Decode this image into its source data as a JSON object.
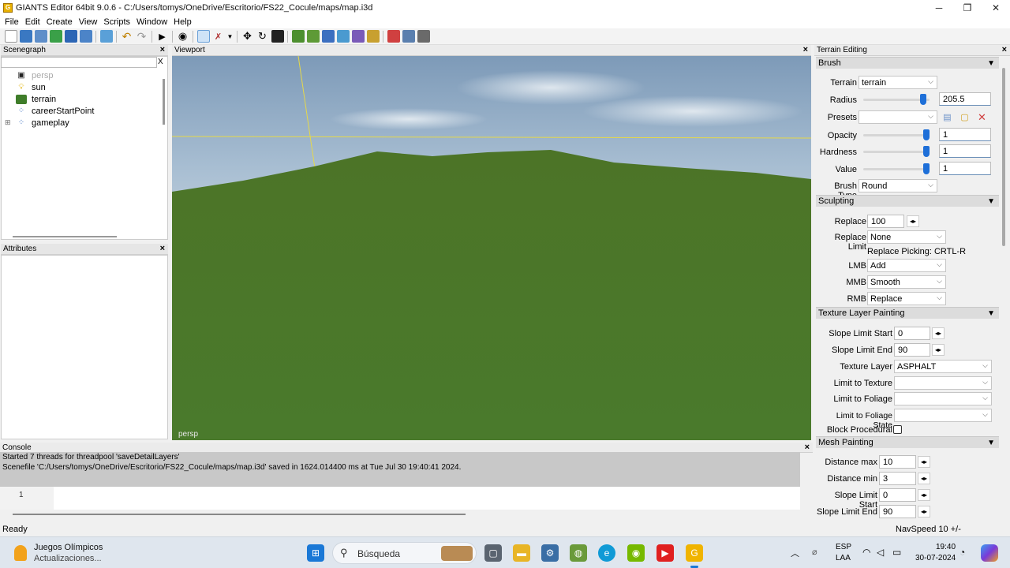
{
  "window": {
    "title": "GIANTS Editor 64bit 9.0.6 - C:/Users/tomys/OneDrive/Escritorio/FS22_Cocule/maps/map.i3d",
    "minimize": "─",
    "maximize": "❐",
    "close": "✕"
  },
  "menu": [
    "File",
    "Edit",
    "Create",
    "View",
    "Scripts",
    "Window",
    "Help"
  ],
  "scenegraph": {
    "title": "Scenegraph",
    "close": "×",
    "search_clear": "X",
    "items": [
      {
        "label": "persp",
        "icon": "camera-icon",
        "dim": true
      },
      {
        "label": "sun",
        "icon": "light-bulb-icon",
        "dim": false
      },
      {
        "label": "terrain",
        "icon": "terrain-icon",
        "dim": false
      },
      {
        "label": "careerStartPoint",
        "icon": "transform-group-icon",
        "dim": false
      },
      {
        "label": "gameplay",
        "icon": "transform-group-icon",
        "dim": false
      }
    ],
    "expander": "⊞"
  },
  "attributes": {
    "title": "Attributes",
    "close": "×"
  },
  "viewport": {
    "title": "Viewport",
    "close": "×",
    "camera_label": "persp"
  },
  "console": {
    "title": "Console",
    "close": "×",
    "lines": [
      "Started 7 threads for threadpool 'saveDetailLayers'",
      "Scenefile 'C:/Users/tomys/OneDrive/Escritorio/FS22_Cocule/maps/map.i3d' saved in 1624.014400 ms at Tue Jul 30 19:40:41 2024."
    ],
    "line_number": "1"
  },
  "status": {
    "left": "Ready",
    "right": "NavSpeed 10 +/-"
  },
  "terrain_editing": {
    "title": "Terrain Editing",
    "close": "×",
    "brush": {
      "header": "Brush",
      "terrain_label": "Terrain",
      "terrain_value": "terrain",
      "radius_label": "Radius",
      "radius_value": "205.5",
      "radius_level": 0.95,
      "presets_label": "Presets",
      "presets_value": "",
      "opacity_label": "Opacity",
      "opacity_value": "1",
      "opacity_level": 1,
      "hardness_label": "Hardness",
      "hardness_value": "1",
      "hardness_level": 1,
      "value_label": "Value",
      "value_value": "1",
      "value_level": 1,
      "brush_type_label": "Brush Type",
      "brush_type_value": "Round"
    },
    "sculpting": {
      "header": "Sculpting",
      "replace_label": "Replace",
      "replace_value": "100",
      "replace_limit_label": "Replace Limit",
      "replace_limit_value": "None",
      "replace_picking": "Replace Picking: CRTL-R",
      "lmb_label": "LMB",
      "lmb_value": "Add",
      "mmb_label": "MMB",
      "mmb_value": "Smooth",
      "rmb_label": "RMB",
      "rmb_value": "Replace"
    },
    "texture": {
      "header": "Texture Layer Painting",
      "slope_start_label": "Slope Limit Start",
      "slope_start_value": "0",
      "slope_end_label": "Slope Limit End",
      "slope_end_value": "90",
      "layer_label": "Texture Layer",
      "layer_value": "ASPHALT",
      "limit_texture_label": "Limit to Texture",
      "limit_texture_value": "",
      "limit_foliage_label": "Limit to Foliage",
      "limit_foliage_value": "",
      "limit_foliage_state_label": "Limit to Foliage State",
      "limit_foliage_state_value": "",
      "block_procedural_label": "Block Procedural"
    },
    "mesh": {
      "header": "Mesh Painting",
      "dist_max_label": "Distance max",
      "dist_max_value": "10",
      "dist_min_label": "Distance min",
      "dist_min_value": "3",
      "slope_start_label": "Slope Limit Start",
      "slope_start_value": "0",
      "slope_end_label": "Slope Limit End",
      "slope_end_value": "90"
    }
  },
  "taskbar": {
    "news_title": "Juegos Olímpicos",
    "news_sub": "Actualizaciones...",
    "search": "Búsqueda",
    "lang_top": "ESP",
    "lang_bottom": "LAA",
    "time": "19:40",
    "date": "30-07-2024"
  },
  "colors": {
    "accent": "#1e6fd8",
    "grass": "#4f7a2c",
    "sky": "#8fa9c4"
  }
}
